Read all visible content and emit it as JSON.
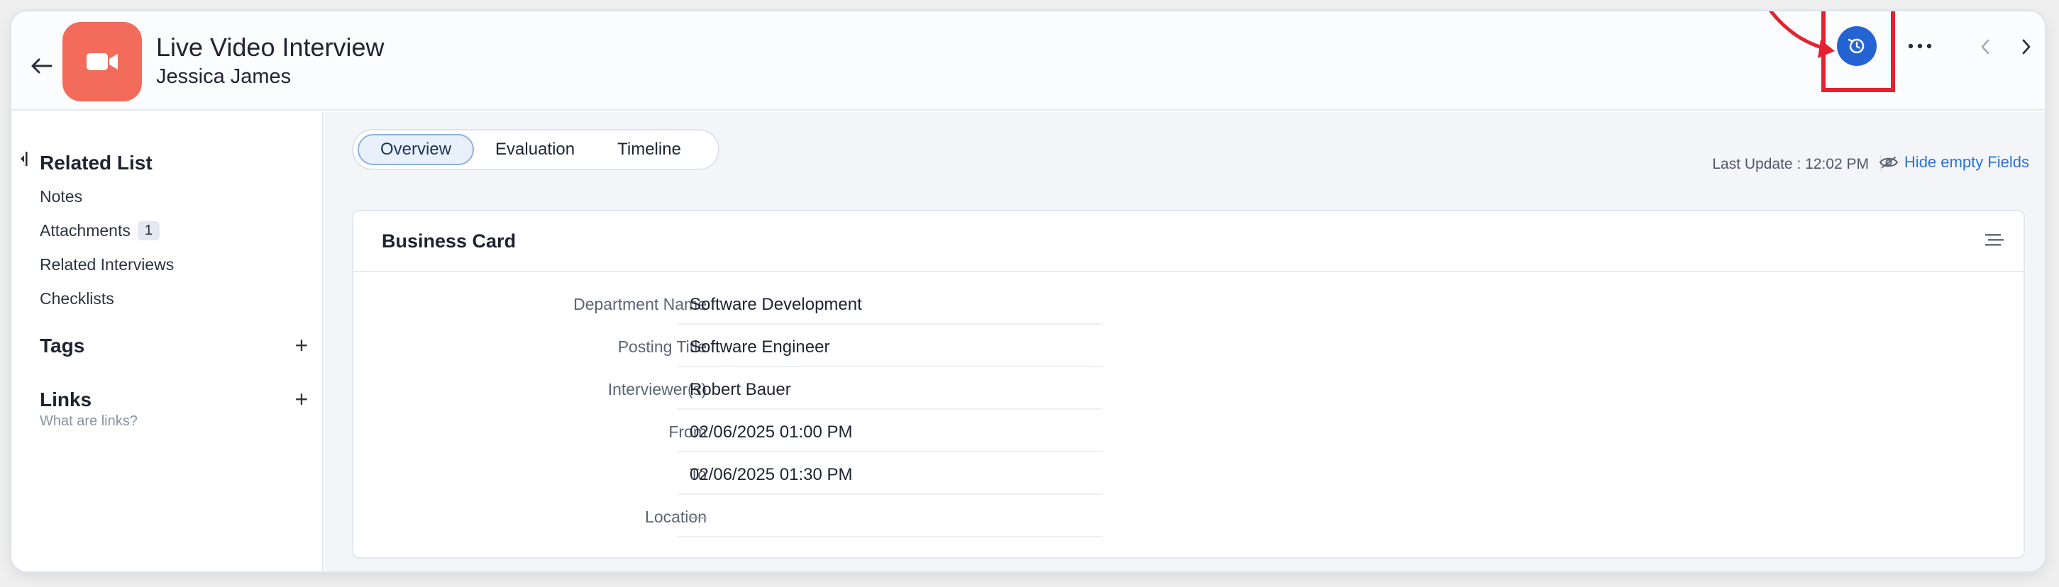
{
  "header": {
    "title": "Live Video Interview",
    "subtitle": "Jessica James",
    "avatar_icon": "video-camera-icon",
    "avatar_color": "#f26b5b",
    "accent_color": "#2463d2",
    "highlight_color": "#e3232f"
  },
  "sidebar": {
    "related_list_heading": "Related List",
    "items": [
      {
        "label": "Notes"
      },
      {
        "label": "Attachments",
        "badge": "1"
      },
      {
        "label": "Related Interviews"
      },
      {
        "label": "Checklists"
      }
    ],
    "tags_heading": "Tags",
    "links_heading": "Links",
    "links_hint": "What are links?",
    "add_symbol": "+"
  },
  "tabs": [
    {
      "label": "Overview",
      "active": true
    },
    {
      "label": "Evaluation",
      "active": false
    },
    {
      "label": "Timeline",
      "active": false
    }
  ],
  "toolbar": {
    "last_update": "Last Update : 12:02 PM",
    "hide_empty": "Hide empty Fields"
  },
  "card": {
    "title": "Business Card",
    "fields": [
      {
        "label": "Department Name",
        "value": "Software Development"
      },
      {
        "label": "Posting Title",
        "value": "Software Engineer"
      },
      {
        "label": "Interviewer(s)",
        "value": "Robert Bauer"
      },
      {
        "label": "From",
        "value": "02/06/2025 01:00 PM"
      },
      {
        "label": "To",
        "value": "02/06/2025 01:30 PM"
      },
      {
        "label": "Location",
        "value": "—"
      }
    ]
  }
}
